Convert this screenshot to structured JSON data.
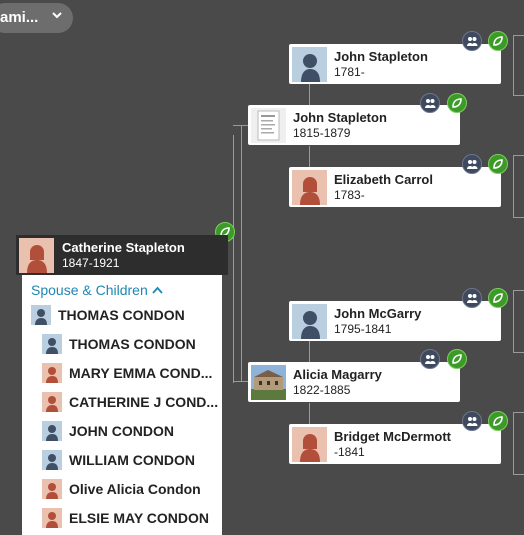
{
  "top_control": {
    "label": "ami...",
    "chevron_icon": "chevron-down-icon"
  },
  "focus_person": {
    "name": "Catherine Stapleton",
    "dates": "1847-1921",
    "avatar": "female-silhouette-icon"
  },
  "spouse_panel": {
    "header": "Spouse & Children",
    "toggle_icon": "chevron-up-icon",
    "spouse": {
      "name": "THOMAS CONDON",
      "avatar": "male-silhouette-icon"
    },
    "children": [
      {
        "name": "THOMAS CONDON",
        "avatar": "male-silhouette-icon"
      },
      {
        "name": "MARY EMMA COND...",
        "avatar": "female-silhouette-icon"
      },
      {
        "name": "CATHERINE J COND...",
        "avatar": "female-silhouette-icon"
      },
      {
        "name": "JOHN CONDON",
        "avatar": "male-silhouette-icon"
      },
      {
        "name": "WILLIAM CONDON",
        "avatar": "male-silhouette-icon"
      },
      {
        "name": "Olive Alicia Condon",
        "avatar": "female-silhouette-icon"
      },
      {
        "name": "ELSIE MAY CONDON",
        "avatar": "female-silhouette-icon"
      }
    ]
  },
  "tree": {
    "father": {
      "name": "John Stapleton",
      "dates": "1815-1879",
      "photo": "document-photo"
    },
    "mother": {
      "name": "Alicia Magarry",
      "dates": "1822-1885",
      "photo": "building-photo"
    },
    "paternal_grandfather": {
      "name": "John Stapleton",
      "dates": "1781-",
      "avatar": "male-silhouette-icon"
    },
    "paternal_grandmother": {
      "name": "Elizabeth Carrol",
      "dates": "1783-",
      "avatar": "female-silhouette-icon"
    },
    "maternal_grandfather": {
      "name": "John McGarry",
      "dates": "1795-1841",
      "avatar": "male-silhouette-icon"
    },
    "maternal_grandmother": {
      "name": "Bridget McDermott",
      "dates": "-1841",
      "avatar": "female-silhouette-icon"
    }
  },
  "colors": {
    "background": "#4a4a4a",
    "link": "#1e87b4",
    "hint_badge": "#3c9a28",
    "family_badge": "#3f4a5e",
    "male_avatar_bg": "#b9cfe0",
    "female_avatar_bg": "#eac0ae"
  }
}
